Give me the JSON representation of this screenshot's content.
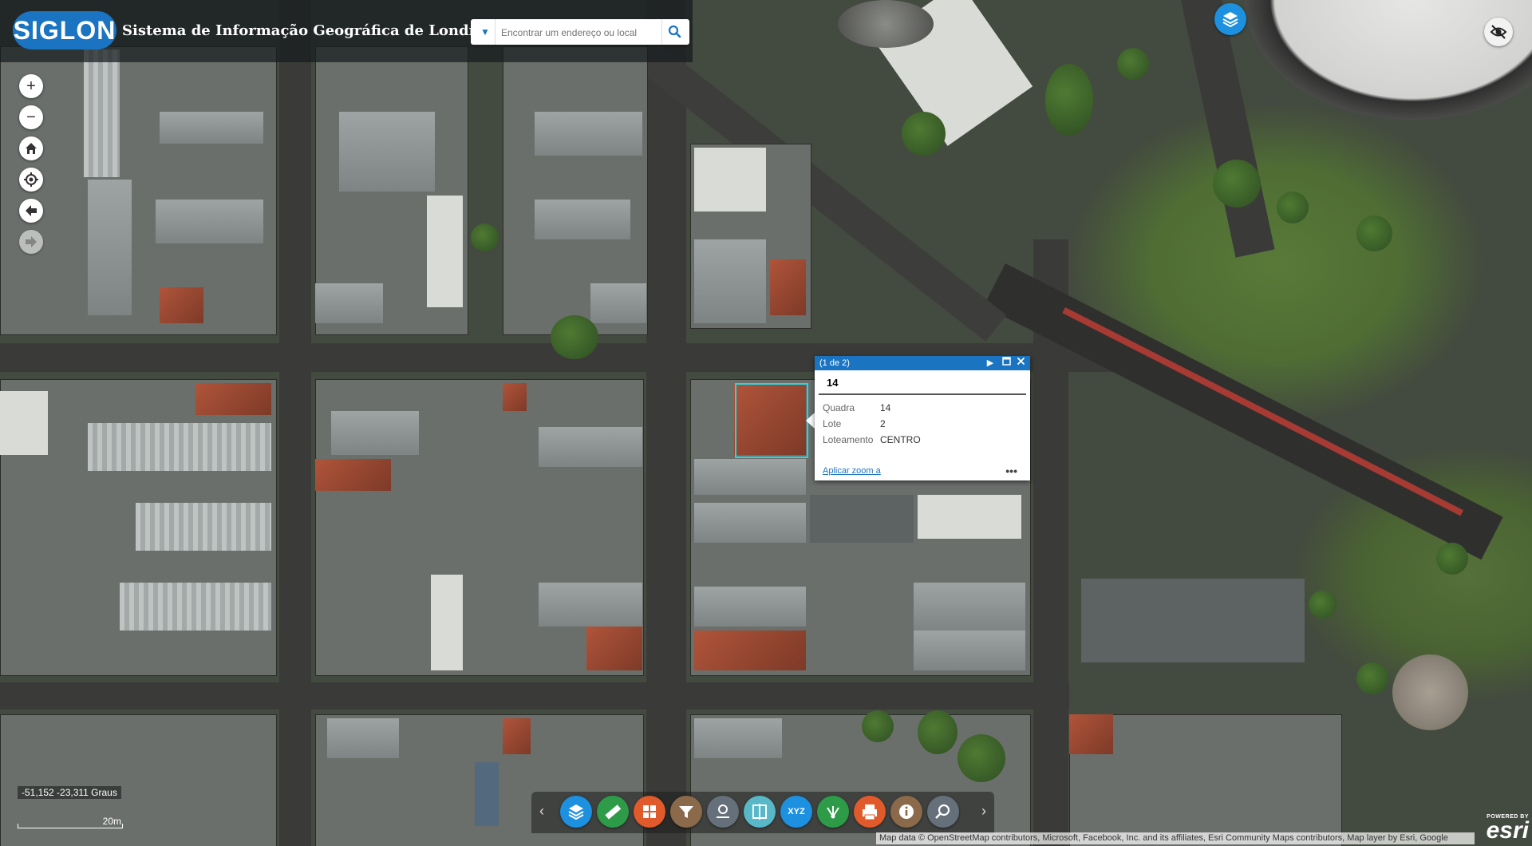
{
  "header": {
    "logo_text": "SIGLON",
    "title": "Sistema de Informação Geográfica de Londrina",
    "search_placeholder": "Encontrar um endereço ou local"
  },
  "icons": {
    "zoom_in": "+",
    "zoom_out": "−",
    "home": "home-icon",
    "locate": "locate-icon",
    "back": "back-arrow-icon",
    "forward": "forward-arrow-icon",
    "layers": "layers-icon",
    "hide_ui": "eye-slash-icon"
  },
  "popup": {
    "pager": "(1 de 2)",
    "feature_title": "14",
    "fields": [
      {
        "label": "Quadra",
        "value": "14"
      },
      {
        "label": "Lote",
        "value": "2"
      },
      {
        "label": "Loteamento",
        "value": "CENTRO"
      }
    ],
    "zoom_link": "Aplicar zoom a",
    "more": "•••"
  },
  "status": {
    "coordinates": "-51,152 -23,311 Graus",
    "scale_label": "20m"
  },
  "toolbar": {
    "tools": [
      {
        "name": "layers-tool",
        "color": "#1e90e0",
        "glyph": "layers-icon"
      },
      {
        "name": "measure-tool",
        "color": "#2e9b48",
        "glyph": "ruler-icon"
      },
      {
        "name": "basemap-tool",
        "color": "#e05a2b",
        "glyph": "grid-icon"
      },
      {
        "name": "filter-tool",
        "color": "#8a6a4a",
        "glyph": "funnel-icon"
      },
      {
        "name": "draw-tool",
        "color": "#66707a",
        "glyph": "draw-icon"
      },
      {
        "name": "swipe-tool",
        "color": "#58b8c8",
        "glyph": "swipe-icon"
      },
      {
        "name": "coordinates-tool",
        "color": "#1e90e0",
        "label": "XYZ"
      },
      {
        "name": "share-tool",
        "color": "#2e9b48",
        "glyph": "share-icon"
      },
      {
        "name": "print-tool",
        "color": "#e05a2b",
        "glyph": "printer-icon"
      },
      {
        "name": "about-tool",
        "color": "#8a6a4a",
        "glyph": "info-icon"
      },
      {
        "name": "query-tool",
        "color": "#66707a",
        "glyph": "zoom-search-icon"
      }
    ]
  },
  "attribution": "Map data © OpenStreetMap contributors, Microsoft, Facebook, Inc. and its affiliates, Esri Community Maps contributors, Map layer by Esri, Google",
  "esri": {
    "powered_by": "POWERED BY",
    "brand": "esri"
  }
}
